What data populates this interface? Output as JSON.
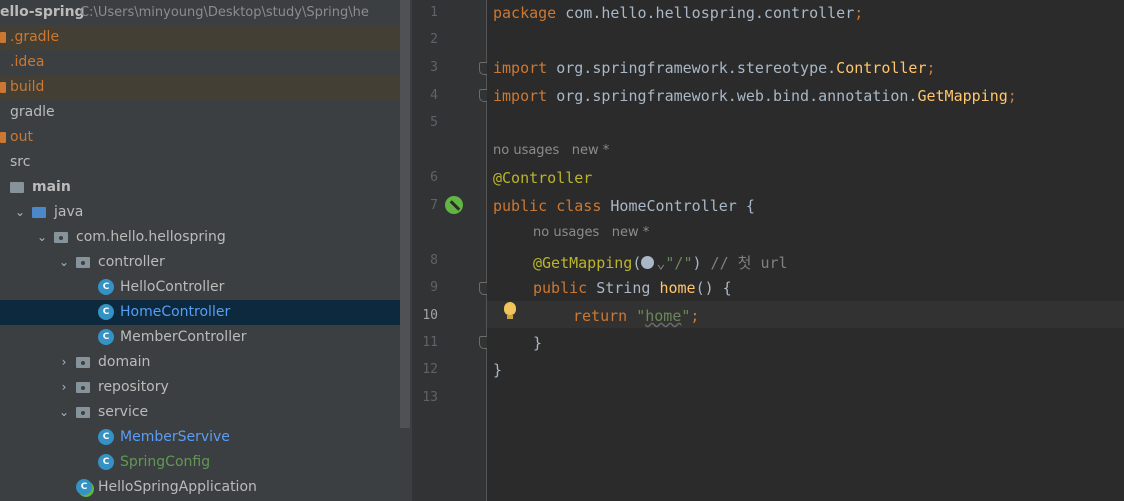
{
  "project": {
    "name": "ello-spring",
    "path": "C:\\Users\\minyoung\\Desktop\\study\\Spring\\he"
  },
  "tree": [
    {
      "label": ".gradle",
      "kind": "folder-orange",
      "style": "orange",
      "excluded": true
    },
    {
      "label": ".idea",
      "kind": "folder",
      "style": "orange",
      "excluded": false
    },
    {
      "label": "build",
      "kind": "folder-orange",
      "style": "orange",
      "excluded": true
    },
    {
      "label": "gradle",
      "kind": "folder",
      "style": "gray",
      "excluded": false
    },
    {
      "label": "out",
      "kind": "folder-orange",
      "style": "orange",
      "excluded": false
    },
    {
      "label": "src",
      "kind": "folder",
      "style": "gray",
      "excluded": false
    },
    {
      "label": "main",
      "kind": "folder",
      "style": "bold",
      "excluded": false
    },
    {
      "label": "java",
      "kind": "folder-blue",
      "style": "gray",
      "excluded": false
    },
    {
      "label": "com.hello.hellospring",
      "kind": "package",
      "style": "gray",
      "excluded": false
    },
    {
      "label": "controller",
      "kind": "package",
      "style": "gray",
      "excluded": false
    },
    {
      "label": "HelloController",
      "kind": "class",
      "style": "gray",
      "excluded": false
    },
    {
      "label": "HomeController",
      "kind": "class",
      "style": "blue",
      "excluded": false,
      "selected": true
    },
    {
      "label": "MemberController",
      "kind": "class",
      "style": "gray",
      "excluded": false
    },
    {
      "label": "domain",
      "kind": "package",
      "style": "gray",
      "excluded": false
    },
    {
      "label": "repository",
      "kind": "package",
      "style": "gray",
      "excluded": false
    },
    {
      "label": "service",
      "kind": "package",
      "style": "gray",
      "excluded": false
    },
    {
      "label": "MemberServive",
      "kind": "class",
      "style": "blue",
      "excluded": false
    },
    {
      "label": "SpringConfig",
      "kind": "class",
      "style": "green",
      "excluded": false
    },
    {
      "label": "HelloSpringApplication",
      "kind": "app",
      "style": "gray",
      "excluded": false
    }
  ],
  "code": {
    "line_numbers": [
      "1",
      "2",
      "3",
      "4",
      "5",
      "6",
      "7",
      "8",
      "9",
      "10",
      "11",
      "12",
      "13"
    ],
    "current_line": "10",
    "package_kw": "package",
    "package_name": " com.hello.hellospring.controller",
    "semicolon": ";",
    "import_kw": "import",
    "import1_pkg": " org.springframework.stereotype.",
    "import1_cls": "Controller",
    "import2_pkg": " org.springframework.web.bind.annotation.",
    "import2_cls": "GetMapping",
    "hint_usages": "no usages",
    "hint_new": "new *",
    "controller_ann": "@Controller",
    "public_kw": "public",
    "class_kw": " class",
    "class_name": " HomeController {",
    "getmapping_ann": "@GetMapping",
    "paren_open": "(",
    "arrow": "⌄",
    "path_str": "\"/\"",
    "paren_close": ")",
    "comment": " // 첫 url",
    "string_type": " String ",
    "method_name": "home",
    "method_tail": "() {",
    "return_kw": "return",
    "return_str_q1": " \"",
    "return_str_val": "home",
    "return_str_q2": "\"",
    "close_inner": "}",
    "close_outer": "}"
  }
}
